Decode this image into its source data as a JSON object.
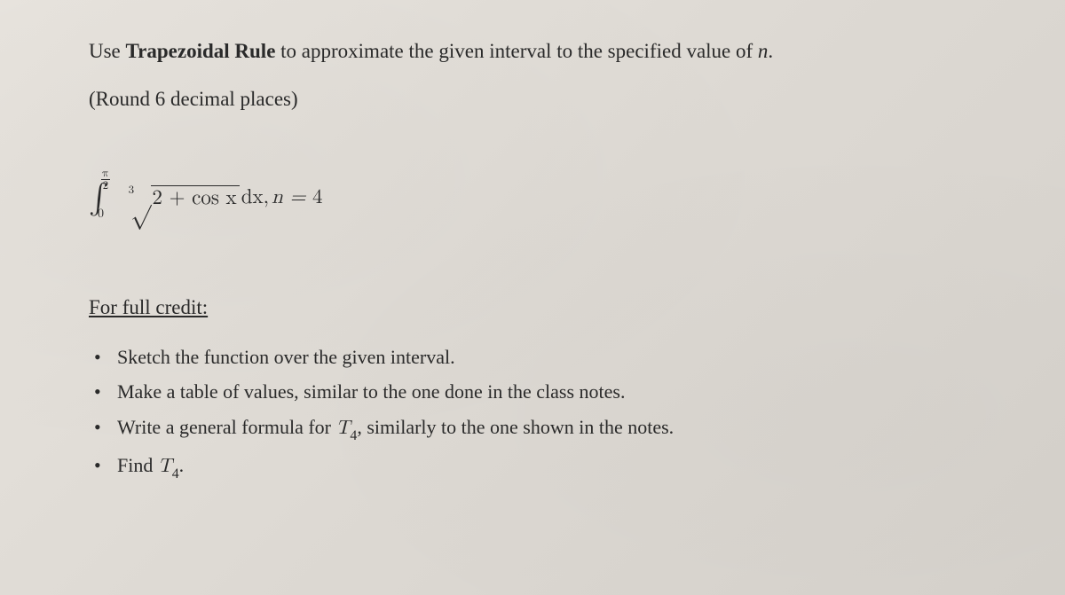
{
  "intro": {
    "prefix": "Use ",
    "bold": "Trapezoidal Rule",
    "middle": " to approximate the given interval to the specified value of ",
    "var": "n",
    "suffix": "."
  },
  "round_note": "(Round 6 decimal places)",
  "integral": {
    "symbol": "∫",
    "upper_num": "π",
    "upper_den": "2",
    "lower": "0",
    "root_index": "3",
    "radical": "√",
    "radicand": "2 + cos x",
    "dx": "dx,",
    "n_label": " n = ",
    "n_value": "4"
  },
  "credit_header": "For full credit:",
  "bullets": [
    {
      "text": "Sketch the function over the given interval."
    },
    {
      "text_pre": "Make a table of values, similar to the one done in the class notes."
    },
    {
      "text_pre": "Write a general formula for ",
      "math_t": "T",
      "math_sub": "4",
      "text_post": ", similarly to the one shown in the notes."
    },
    {
      "text_pre": "Find ",
      "math_t": "T",
      "math_sub": "4",
      "text_post": "."
    }
  ]
}
